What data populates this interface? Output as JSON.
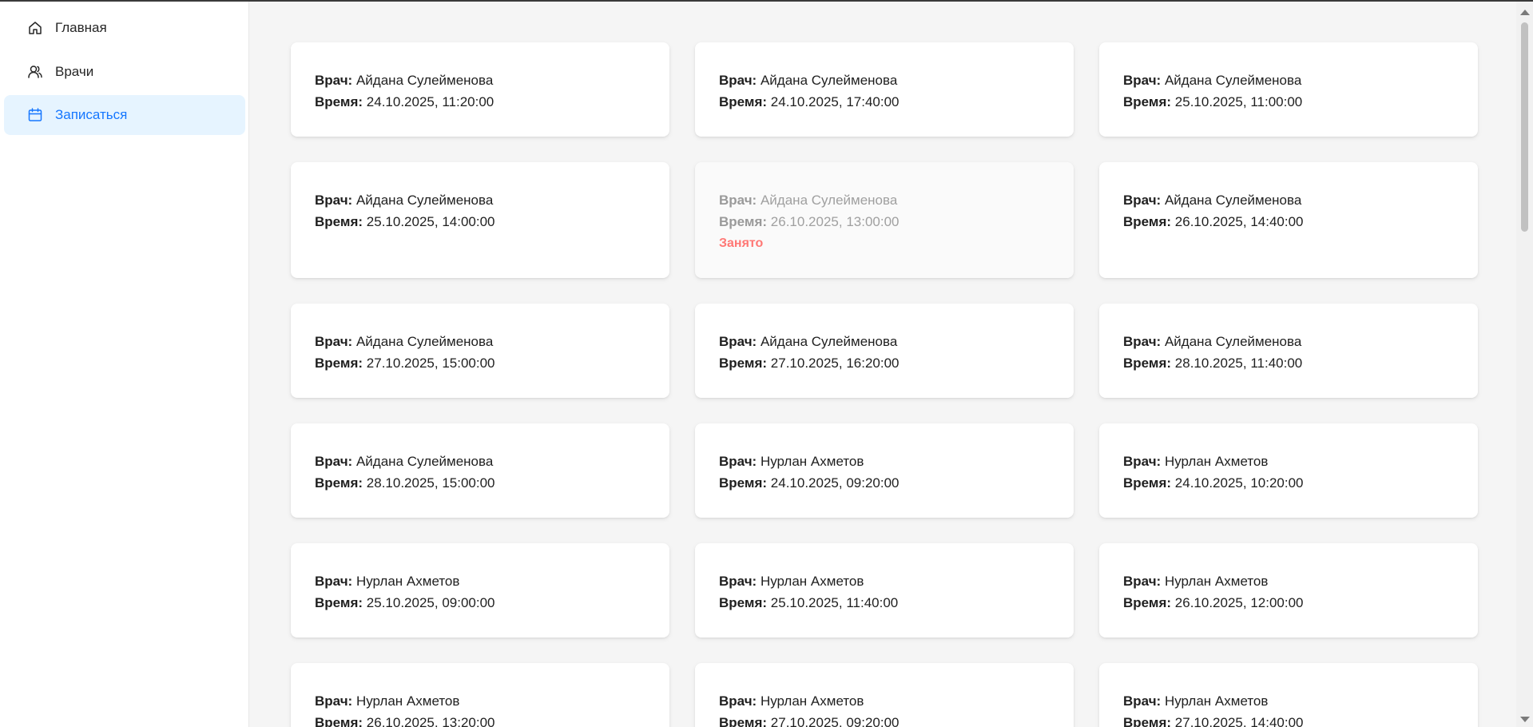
{
  "sidebar": {
    "items": [
      {
        "label": "Главная",
        "icon": "home-icon"
      },
      {
        "label": "Врачи",
        "icon": "doctors-icon"
      },
      {
        "label": "Записаться",
        "icon": "calendar-icon",
        "active": true
      }
    ],
    "accent_color": "#1677ff"
  },
  "slots": {
    "doctor_label": "Врач:",
    "time_label": "Время:",
    "busy_label": "Занято",
    "items": [
      {
        "doctor": "Айдана Сулейменова",
        "time": "24.10.2025, 11:20:00"
      },
      {
        "doctor": "Айдана Сулейменова",
        "time": "24.10.2025, 17:40:00"
      },
      {
        "doctor": "Айдана Сулейменова",
        "time": "25.10.2025, 11:00:00"
      },
      {
        "doctor": "Айдана Сулейменова",
        "time": "25.10.2025, 14:00:00"
      },
      {
        "doctor": "Айдана Сулейменова",
        "time": "26.10.2025, 13:00:00",
        "status": "Занято"
      },
      {
        "doctor": "Айдана Сулейменова",
        "time": "26.10.2025, 14:40:00"
      },
      {
        "doctor": "Айдана Сулейменова",
        "time": "27.10.2025, 15:00:00"
      },
      {
        "doctor": "Айдана Сулейменова",
        "time": "27.10.2025, 16:20:00"
      },
      {
        "doctor": "Айдана Сулейменова",
        "time": "28.10.2025, 11:40:00"
      },
      {
        "doctor": "Айдана Сулейменова",
        "time": "28.10.2025, 15:00:00"
      },
      {
        "doctor": "Нурлан Ахметов",
        "time": "24.10.2025, 09:20:00"
      },
      {
        "doctor": "Нурлан Ахметов",
        "time": "24.10.2025, 10:20:00"
      },
      {
        "doctor": "Нурлан Ахметов",
        "time": "25.10.2025, 09:00:00"
      },
      {
        "doctor": "Нурлан Ахметов",
        "time": "25.10.2025, 11:40:00"
      },
      {
        "doctor": "Нурлан Ахметов",
        "time": "26.10.2025, 12:00:00"
      },
      {
        "doctor": "Нурлан Ахметов",
        "time": "26.10.2025, 13:20:00"
      },
      {
        "doctor": "Нурлан Ахметов",
        "time": "27.10.2025, 09:20:00"
      },
      {
        "doctor": "Нурлан Ахметов",
        "time": "27.10.2025, 14:40:00"
      }
    ],
    "busy_color": "#ff7875"
  }
}
